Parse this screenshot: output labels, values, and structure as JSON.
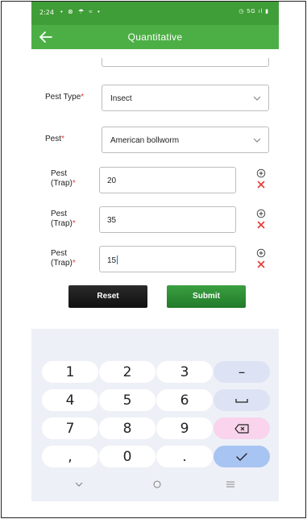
{
  "status_bar": {
    "time": "2:24",
    "left_icons": "• ⊗ ☂ ≈ •",
    "right_icons": "◷ 5G ıl ▮"
  },
  "app_bar": {
    "title": "Quantitative",
    "back_icon": "arrow-left-icon",
    "color": "#4caf45"
  },
  "form": {
    "pest_type": {
      "label": "Pest Type",
      "required_mark": "*",
      "value": "Insect"
    },
    "pest": {
      "label": "Pest",
      "required_mark": "*",
      "value": "American bollworm"
    },
    "trap_rows": [
      {
        "label_line1": "Pest",
        "label_line2": "(Trap)",
        "required_mark": "*",
        "value": "20"
      },
      {
        "label_line1": "Pest",
        "label_line2": "(Trap)",
        "required_mark": "*",
        "value": "35"
      },
      {
        "label_line1": "Pest",
        "label_line2": "(Trap)",
        "required_mark": "*",
        "value": "15"
      }
    ],
    "reset_label": "Reset",
    "submit_label": "Submit"
  },
  "keyboard": {
    "keys": [
      "1",
      "2",
      "3",
      "–",
      "4",
      "5",
      "6",
      "␣",
      "7",
      "8",
      "9",
      "⌫",
      ",",
      "0",
      ".",
      "✓"
    ]
  },
  "colors": {
    "accent_green": "#4caf45",
    "required_red": "#e53935",
    "delete_icon_red": "#e53935"
  }
}
